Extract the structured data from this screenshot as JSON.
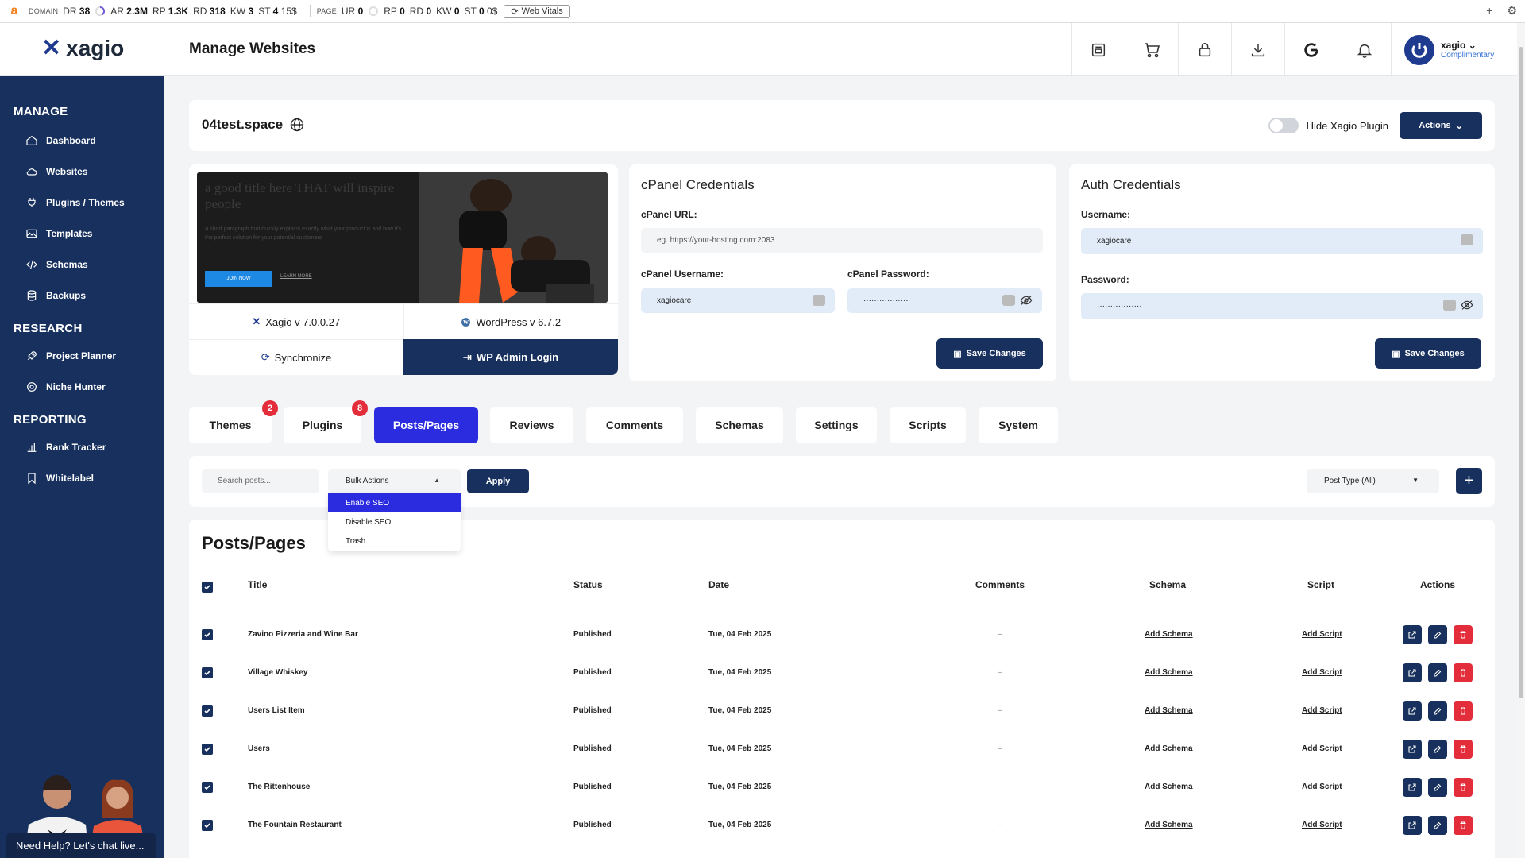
{
  "ext": {
    "domain_label": "DOMAIN",
    "dr_label": "DR",
    "dr": "38",
    "ar_label": "AR",
    "ar": "2.3M",
    "rp_label": "RP",
    "rp": "1.3K",
    "rd_label": "RD",
    "rd": "318",
    "kw_label": "KW",
    "kw": "3",
    "st_label": "ST",
    "st": "4",
    "st_value": "15$",
    "page_label": "PAGE",
    "ur_label": "UR",
    "ur": "0",
    "prp_label": "RP",
    "prp": "0",
    "prd_label": "RD",
    "prd": "0",
    "pkw_label": "KW",
    "pkw": "0",
    "pst_label": "ST",
    "pst": "0",
    "pst_value": "0$",
    "web_vitals": "Web Vitals"
  },
  "header": {
    "brand": "xagio",
    "page_title": "Manage Websites",
    "user_name": "xagio",
    "user_tier": "Complimentary"
  },
  "sidebar": {
    "manage_title": "MANAGE",
    "manage_items": [
      {
        "label": "Dashboard",
        "icon": "home-icon"
      },
      {
        "label": "Websites",
        "icon": "cloud-icon"
      },
      {
        "label": "Plugins / Themes",
        "icon": "plug-icon"
      },
      {
        "label": "Templates",
        "icon": "image-icon"
      },
      {
        "label": "Schemas",
        "icon": "code-icon"
      },
      {
        "label": "Backups",
        "icon": "database-icon"
      }
    ],
    "research_title": "RESEARCH",
    "research_items": [
      {
        "label": "Project Planner",
        "icon": "rocket-icon"
      },
      {
        "label": "Niche Hunter",
        "icon": "target-icon"
      }
    ],
    "reporting_title": "REPORTING",
    "reporting_items": [
      {
        "label": "Rank Tracker",
        "icon": "bar-chart-icon"
      },
      {
        "label": "Whitelabel",
        "icon": "bookmark-icon"
      }
    ],
    "help_text": "Need Help? Let's chat live..."
  },
  "site": {
    "name": "04test.space",
    "hide_plugin_label": "Hide Xagio Plugin",
    "actions_label": "Actions"
  },
  "preview": {
    "headline": "a good title here THAT will inspire people",
    "paragraph": "A short paragraph that quickly explains exactly what your product is and how it's the perfect solution for your potential customers",
    "join_btn": "JOIN NOW",
    "learn_btn": "LEARN MORE",
    "xagio_version": "Xagio v 7.0.0.27",
    "wp_version": "WordPress v 6.7.2",
    "sync_label": "Synchronize",
    "wp_login_label": "WP Admin Login"
  },
  "cpanel": {
    "title": "cPanel Credentials",
    "url_label": "cPanel URL:",
    "url_placeholder": "eg. https://your-hosting.com:2083",
    "username_label": "cPanel Username:",
    "username_value": "xagiocare",
    "password_label": "cPanel Password:",
    "password_value": "·················",
    "save_label": "Save Changes"
  },
  "auth": {
    "title": "Auth Credentials",
    "username_label": "Username:",
    "username_value": "xagiocare",
    "password_label": "Password:",
    "password_value": "·················",
    "save_label": "Save Changes"
  },
  "tabs": [
    {
      "label": "Themes",
      "badge": "2"
    },
    {
      "label": "Plugins",
      "badge": "8"
    },
    {
      "label": "Posts/Pages",
      "badge": ""
    },
    {
      "label": "Reviews",
      "badge": ""
    },
    {
      "label": "Comments",
      "badge": ""
    },
    {
      "label": "Schemas",
      "badge": ""
    },
    {
      "label": "Settings",
      "badge": ""
    },
    {
      "label": "Scripts",
      "badge": ""
    },
    {
      "label": "System",
      "badge": ""
    }
  ],
  "filters": {
    "search_placeholder": "Search posts...",
    "bulk_label": "Bulk Actions",
    "bulk_options": [
      "Enable SEO",
      "Disable SEO",
      "Trash"
    ],
    "apply_label": "Apply",
    "post_type_label": "Post Type (All)",
    "add_label": "+"
  },
  "table": {
    "title": "Posts/Pages",
    "columns": [
      "Title",
      "Status",
      "Date",
      "Comments",
      "Schema",
      "Script",
      "Actions"
    ],
    "rows": [
      {
        "title": "Zavino Pizzeria and Wine Bar",
        "status": "Published",
        "date": "Tue, 04 Feb 2025",
        "comments": "–",
        "schema": "Add Schema",
        "script": "Add Script"
      },
      {
        "title": "Village Whiskey",
        "status": "Published",
        "date": "Tue, 04 Feb 2025",
        "comments": "–",
        "schema": "Add Schema",
        "script": "Add Script"
      },
      {
        "title": "Users List Item",
        "status": "Published",
        "date": "Tue, 04 Feb 2025",
        "comments": "–",
        "schema": "Add Schema",
        "script": "Add Script"
      },
      {
        "title": "Users",
        "status": "Published",
        "date": "Tue, 04 Feb 2025",
        "comments": "–",
        "schema": "Add Schema",
        "script": "Add Script"
      },
      {
        "title": "The Rittenhouse",
        "status": "Published",
        "date": "Tue, 04 Feb 2025",
        "comments": "–",
        "schema": "Add Schema",
        "script": "Add Script"
      },
      {
        "title": "The Fountain Restaurant",
        "status": "Published",
        "date": "Tue, 04 Feb 2025",
        "comments": "–",
        "schema": "Add Schema",
        "script": "Add Script"
      }
    ]
  },
  "colors": {
    "sidebar": "#17305e",
    "primary": "#17305e",
    "active_tab": "#2b2be0",
    "danger": "#e42d3a"
  }
}
